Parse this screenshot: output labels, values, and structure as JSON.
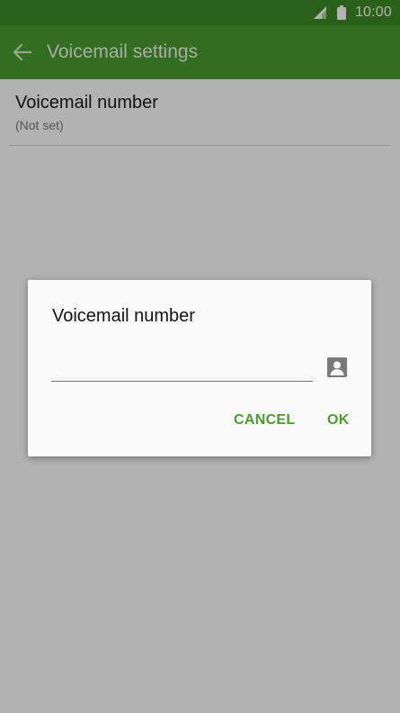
{
  "status_bar": {
    "time": "10:00",
    "signal_icon": "signal-icon",
    "battery_icon": "battery-icon"
  },
  "app_bar": {
    "title": "Voicemail settings",
    "back_icon": "arrow-left-icon"
  },
  "settings": {
    "items": [
      {
        "title": "Voicemail number",
        "summary": "(Not set)"
      }
    ]
  },
  "dialog": {
    "title": "Voicemail number",
    "input_value": "",
    "contact_icon": "contact-icon",
    "cancel_label": "CANCEL",
    "ok_label": "OK"
  },
  "colors": {
    "status_bar": "#3c8a26",
    "app_bar": "#4a9c2f",
    "accent": "#4a9c2f"
  }
}
